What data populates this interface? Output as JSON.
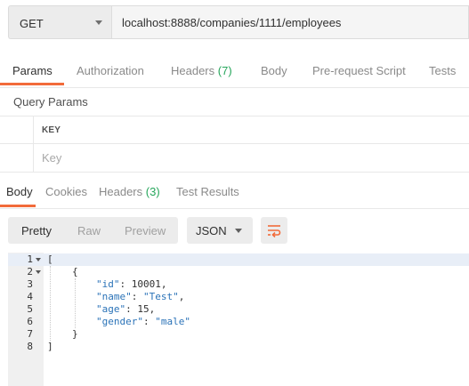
{
  "request": {
    "method": "GET",
    "url": "localhost:8888/companies/1111/employees"
  },
  "request_tabs": {
    "params": "Params",
    "authorization": "Authorization",
    "headers": "Headers",
    "headers_count": "(7)",
    "body": "Body",
    "prerequest": "Pre-request Script",
    "tests": "Tests"
  },
  "query_params": {
    "title": "Query Params",
    "key_header": "KEY",
    "key_placeholder": "Key"
  },
  "response_tabs": {
    "body": "Body",
    "cookies": "Cookies",
    "headers": "Headers",
    "headers_count": "(3)",
    "test_results": "Test Results"
  },
  "response_toolbar": {
    "pretty": "Pretty",
    "raw": "Raw",
    "preview": "Preview",
    "format": "JSON"
  },
  "code": {
    "line_numbers": [
      "1",
      "2",
      "3",
      "4",
      "5",
      "6",
      "7",
      "8"
    ],
    "open_bracket": "[",
    "open_brace": "{",
    "id_key": "\"id\"",
    "id_value": "10001",
    "name_key": "\"name\"",
    "name_value": "\"Test\"",
    "age_key": "\"age\"",
    "age_value": "15",
    "gender_key": "\"gender\"",
    "gender_value": "\"male\"",
    "close_brace": "}",
    "close_bracket": "]"
  },
  "colors": {
    "accent": "#f26b3a",
    "count_green": "#26a65b",
    "json_key": "#2b73b8"
  },
  "icons": {
    "method_dropdown": "chevron-down-icon",
    "format_dropdown": "chevron-down-icon",
    "wrap": "wrap-lines-icon"
  }
}
